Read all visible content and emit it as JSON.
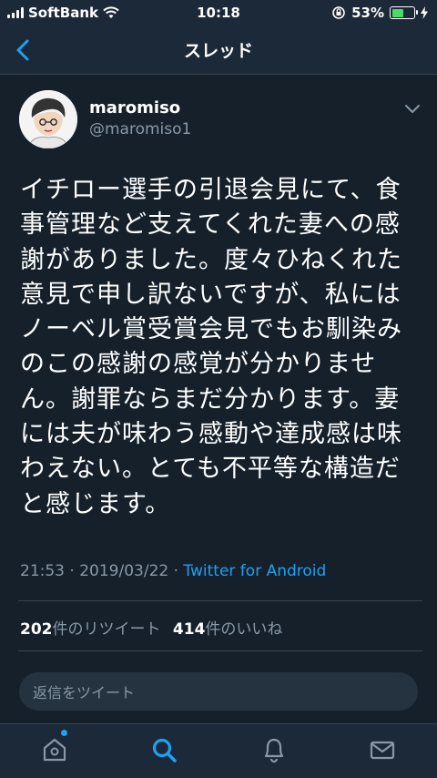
{
  "status_bar": {
    "carrier": "SoftBank",
    "time": "10:18",
    "battery_percent": "53%",
    "battery_level": 0.53
  },
  "nav": {
    "title": "スレッド"
  },
  "tweet": {
    "user_name": "maromiso",
    "user_handle": "@maromiso1",
    "text": "イチロー選手の引退会見にて、食\n事管理など支えてくれた妻への感\n謝がありました。度々ひねくれた\n意見で申し訳ないですが、私には\nノーベル賞受賞会見でもお馴染み\nのこの感謝の感覚が分かりませ\nん。謝罪ならまだ分かります。妻\nには夫が味わう感動や達成感は味\nわえない。とても不平等な構造だ\nと感じます。",
    "time": "21:53",
    "date": "2019/03/22",
    "separator": " · ",
    "source": "Twitter for Android",
    "retweet_count": "202",
    "retweet_label": "件のリツイート",
    "like_count": "414",
    "like_label": "件のいいね"
  },
  "reply": {
    "placeholder": "返信をツイート"
  },
  "tabs": {
    "home_icon": "home-icon",
    "search_icon": "search-icon",
    "notifications_icon": "bell-icon",
    "messages_icon": "mail-icon",
    "accent_color": "#1da1f2"
  }
}
